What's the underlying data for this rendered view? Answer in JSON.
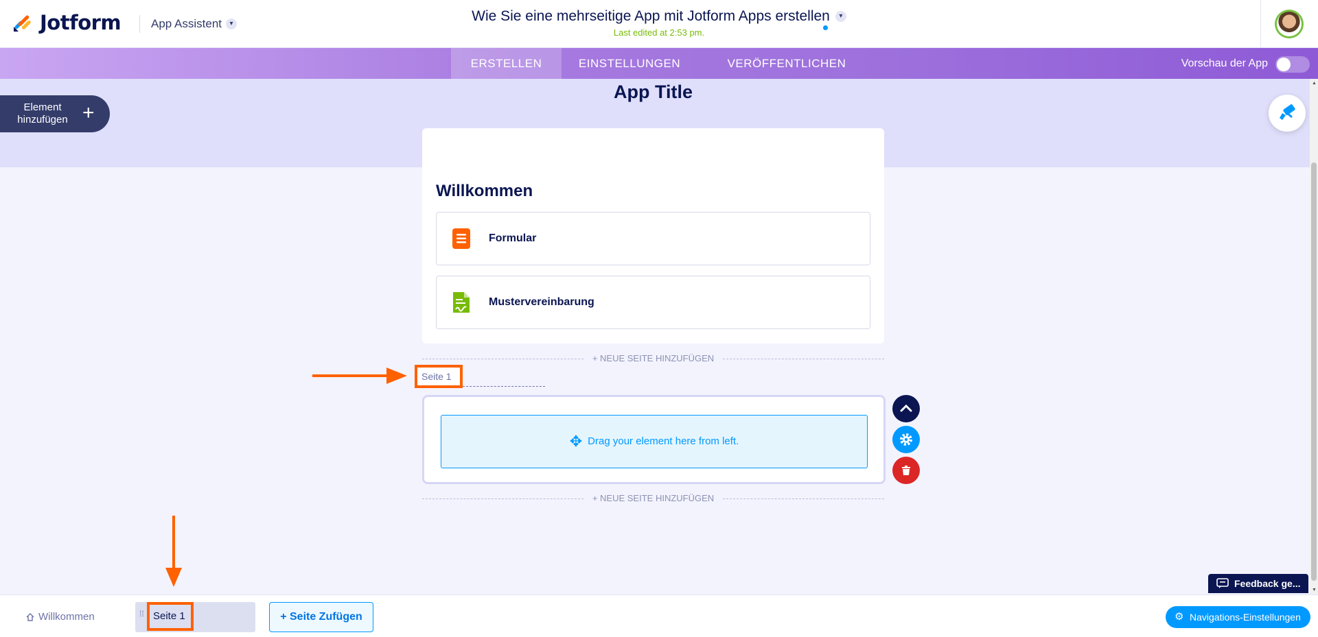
{
  "header": {
    "brand": "Jotform",
    "app_assistant": "App Assistent",
    "app_name": "Wie Sie eine mehrseitige App mit Jotform Apps erstellen",
    "last_edited": "Last edited at 2:53 pm."
  },
  "navbar": {
    "tabs": [
      {
        "label": "ERSTELLEN",
        "active": true
      },
      {
        "label": "EINSTELLUNGEN",
        "active": false
      },
      {
        "label": "VERÖFFENTLICHEN",
        "active": false
      }
    ],
    "preview_label": "Vorschau der App",
    "preview_enabled": false
  },
  "canvas": {
    "app_title": "App Title",
    "add_element_label": "Element hinzufügen",
    "welcome_page": {
      "heading": "Willkommen",
      "items": [
        {
          "label": "Formular",
          "icon": "form-icon",
          "color": "#ff6100"
        },
        {
          "label": "Mustervereinbarung",
          "icon": "document-sign-icon",
          "color": "#78bb07"
        }
      ]
    },
    "add_page_label": "+ NEUE SEITE HINZUFÜGEN",
    "new_page": {
      "label": "Seite 1",
      "drop_hint": "Drag your element here from left."
    },
    "feedback_label": "Feedback ge..."
  },
  "bottom_bar": {
    "home_label": "Willkommen",
    "page_label": "Seite 1",
    "add_page_label": "+ Seite Zufügen",
    "nav_settings_label": "Navigations-Einstellungen"
  },
  "colors": {
    "accent": "#0099ff",
    "highlight": "#ff6100",
    "navy": "#0a1551",
    "danger": "#dc2626"
  }
}
